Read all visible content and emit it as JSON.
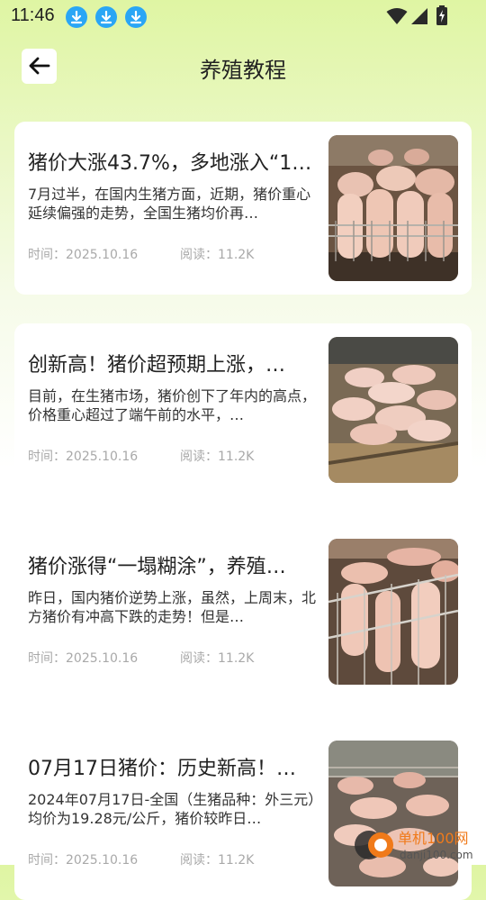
{
  "status_bar": {
    "time": "11:46",
    "notification_icons": [
      "download-icon",
      "download-icon",
      "download-icon"
    ],
    "system_icons": [
      "wifi-icon",
      "signal-icon",
      "battery-charging-icon"
    ],
    "accent": "#2aa6f5"
  },
  "header": {
    "title": "养殖教程",
    "back_icon": "arrow-left-icon"
  },
  "articles": [
    {
      "title": "猪价大涨43.7%，多地涨入“1…",
      "excerpt": "7月过半，在国内生猪方面，近期，猪价重心延续偏强的走势，全国生猪均价再…",
      "time_label": "时间：2025.10.16",
      "reads_label": "阅读：11.2K",
      "image": "pigs-in-pen-photo"
    },
    {
      "title": "创新高！猪价超预期上涨，…",
      "excerpt": "目前，在生猪市场，猪价创下了年内的高点，价格重心超过了端午前的水平，…",
      "time_label": "时间：2025.10.16",
      "reads_label": "阅读：11.2K",
      "image": "piglets-lying-photo"
    },
    {
      "title": "猪价涨得“一塌糊涂”，养殖…",
      "excerpt": "昨日，国内猪价逆势上涨，虽然，上周末，北方猪价有冲高下跌的走势！但是…",
      "time_label": "时间：2025.10.16",
      "reads_label": "阅读：11.2K",
      "image": "pigs-behind-fence-photo"
    },
    {
      "title": "07月17日猪价：历史新高！…",
      "excerpt": "2024年07月17日-全国（生猪品种：外三元）均价为19.28元/公斤，猪价较昨日…",
      "time_label": "时间：2025.10.16",
      "reads_label": "阅读：11.2K",
      "image": "pig-farm-photo"
    }
  ],
  "watermark": {
    "cn": "单机100网",
    "url": "danji100.com"
  }
}
